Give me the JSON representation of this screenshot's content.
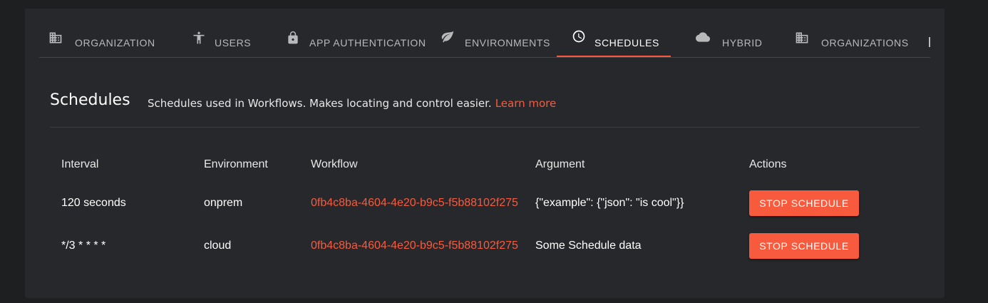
{
  "tabs": [
    {
      "label": "Organization",
      "icon": "building-icon"
    },
    {
      "label": "Users",
      "icon": "accessibility-icon"
    },
    {
      "label": "App Authentication",
      "icon": "lock-icon"
    },
    {
      "label": "Environments",
      "icon": "leaf-icon"
    },
    {
      "label": "Schedules",
      "icon": "clock-icon",
      "active": true
    },
    {
      "label": "Hybrid",
      "icon": "cloud-icon"
    },
    {
      "label": "Organizations",
      "icon": "building-icon"
    }
  ],
  "section": {
    "title": "Schedules",
    "description": "Schedules used in Workflows. Makes locating and control easier.",
    "learn_more": "Learn more"
  },
  "table": {
    "headers": [
      "Interval",
      "Environment",
      "Workflow",
      "Argument",
      "Actions"
    ],
    "rows": [
      {
        "interval": "120 seconds",
        "environment": "onprem",
        "workflow": "0fb4c8ba-4604-4e20-b9c5-f5b88102f275",
        "argument": "{\"example\": {\"json\": \"is cool\"}}",
        "action": "Stop Schedule"
      },
      {
        "interval": "*/3 * * * *",
        "environment": "cloud",
        "workflow": "0fb4c8ba-4604-4e20-b9c5-f5b88102f275",
        "argument": "Some Schedule data",
        "action": "Stop Schedule"
      }
    ]
  },
  "colors": {
    "accent": "#f85a3e",
    "card_bg": "#27282b",
    "page_bg": "#1e1f21"
  }
}
